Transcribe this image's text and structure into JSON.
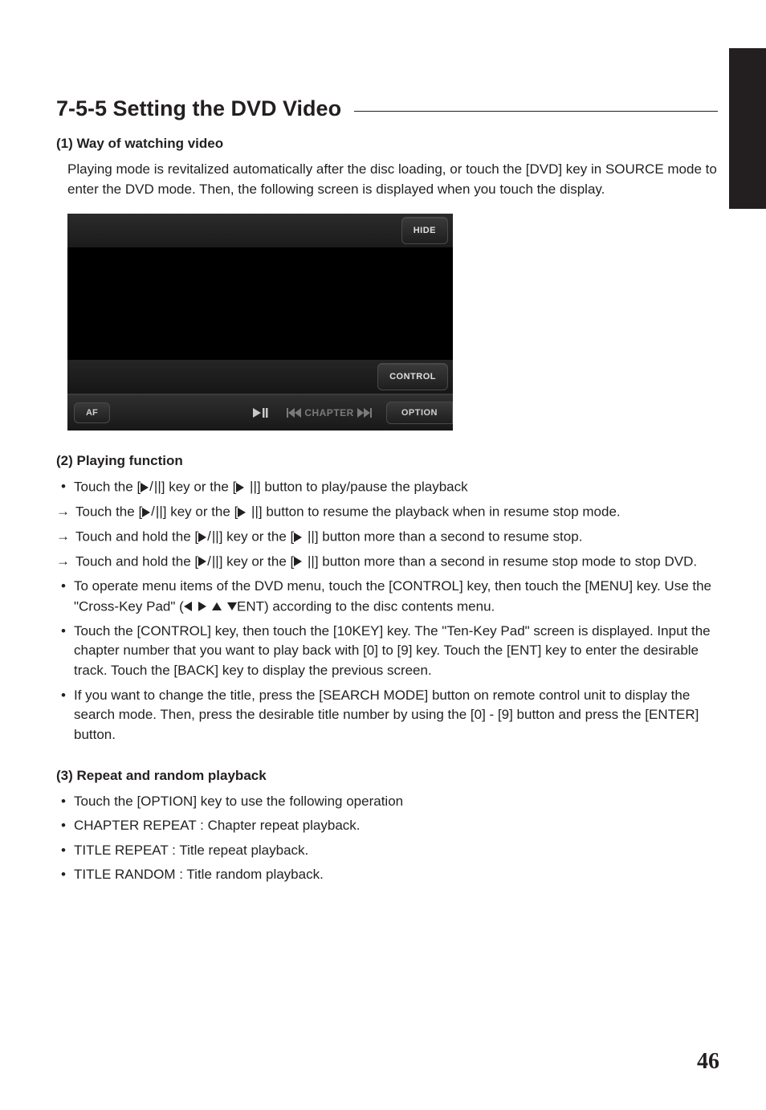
{
  "heading": "7-5-5 Setting the DVD Video",
  "s1": {
    "title": "(1) Way of watching video",
    "body": "Playing mode is revitalized automatically after the disc loading, or touch the [DVD] key in SOURCE mode to enter the DVD mode. Then, the following screen is displayed when you touch the display."
  },
  "screenshot": {
    "hide": "HIDE",
    "control": "CONTROL",
    "af": "AF",
    "chapter": "CHAPTER",
    "option": "OPTION"
  },
  "s2": {
    "title": "(2) Playing function",
    "items": [
      {
        "type": "dot",
        "pre": "Touch the [",
        "icon": "playpause",
        "mid": "] key or the [",
        "icon2": "playpause2",
        "post": "] button to play/pause the playback"
      },
      {
        "type": "arrow",
        "pre": "Touch the [",
        "icon": "playpause",
        "mid": "] key or the [",
        "icon2": "playpause2",
        "post": "] button to resume the playback when in resume stop mode."
      },
      {
        "type": "arrow",
        "pre": "Touch and hold the [",
        "icon": "playpause",
        "mid": "] key or the [",
        "icon2": "playpause2",
        "post": "] button more than a second to resume stop."
      },
      {
        "type": "arrow",
        "pre": "Touch and hold the [",
        "icon": "playpause",
        "mid": "] key or the [",
        "icon2": "playpause2",
        "post": "] button more than a second in resume stop mode to stop DVD."
      },
      {
        "type": "dot",
        "full_pre": "To operate menu items of the DVD menu, touch the [CONTROL] key, then touch the [MENU] key. Use the \"Cross-Key Pad\" (",
        "full_post": "ENT) according to the disc contents menu."
      },
      {
        "type": "dot",
        "plain": "Touch the [CONTROL] key, then touch the [10KEY] key. The \"Ten-Key Pad\" screen is displayed. Input the chapter number that you want to play back with [0] to [9] key. Touch the [ENT] key to enter the desirable track. Touch the [BACK] key to display the previous screen."
      },
      {
        "type": "dot",
        "plain": "If you want to change the title, press the [SEARCH MODE] button on remote control unit to display the search mode. Then, press the desirable title number by using the [0] - [9] button and press the [ENTER] button."
      }
    ]
  },
  "s3": {
    "title": "(3) Repeat and random playback",
    "items": [
      "Touch the [OPTION] key to use the following operation",
      "CHAPTER REPEAT  : Chapter repeat playback.",
      "TITLE REPEAT  : Title repeat playback.",
      "TITLE RANDOM  : Title random playback."
    ]
  },
  "pageNumber": "46"
}
